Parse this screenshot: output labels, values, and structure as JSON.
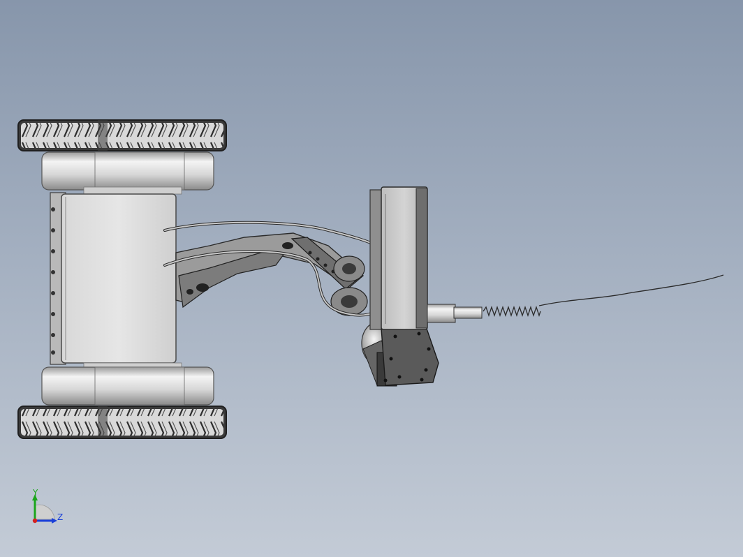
{
  "triad": {
    "y_label": "Y",
    "z_label": "Z",
    "y_color": "#1aa51a",
    "z_color": "#1a3fd8",
    "origin_color": "#d42020"
  },
  "background": {
    "top_color": "#8796ab",
    "bottom_color": "#c3cbd6"
  }
}
